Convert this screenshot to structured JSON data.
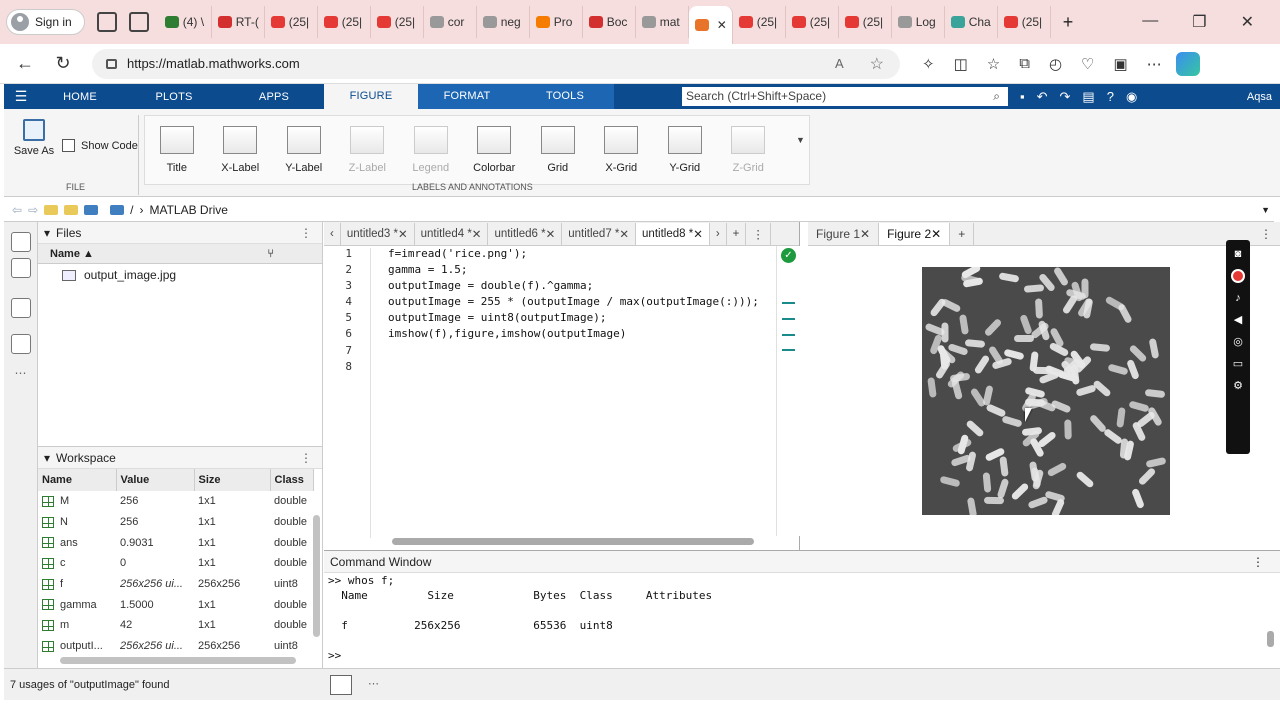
{
  "browser": {
    "signin_label": "Sign in",
    "tabs": [
      {
        "label": "(4) \\",
        "color": "#2e7d32"
      },
      {
        "label": "RT-(",
        "color": "#d32f2f"
      },
      {
        "label": "(25|",
        "color": "#e53935"
      },
      {
        "label": "(25|",
        "color": "#e53935"
      },
      {
        "label": "(25|",
        "color": "#e53935"
      },
      {
        "label": "cor",
        "color": "#999999"
      },
      {
        "label": "neg",
        "color": "#999999"
      },
      {
        "label": "Pro",
        "color": "#f57c00"
      },
      {
        "label": "Boc",
        "color": "#d32f2f"
      },
      {
        "label": "mat",
        "color": "#999999"
      },
      {
        "label": "",
        "color": "#e8742a"
      },
      {
        "label": "(25|",
        "color": "#e53935"
      },
      {
        "label": "(25|",
        "color": "#e53935"
      },
      {
        "label": "(25|",
        "color": "#e53935"
      },
      {
        "label": "Log",
        "color": "#999999"
      },
      {
        "label": "Cha",
        "color": "#3aa39a"
      },
      {
        "label": "(25|",
        "color": "#e53935"
      }
    ],
    "url": "https://matlab.mathworks.com",
    "aa_label": "Aᴬ"
  },
  "matlab": {
    "tabs": [
      "HOME",
      "PLOTS",
      "APPS",
      "FIGURE",
      "FORMAT",
      "TOOLS"
    ],
    "search_placeholder": "Search (Ctrl+Shift+Space)",
    "user": "Aqsa",
    "ribbon": {
      "save_as": "Save As",
      "show_code": "Show Code",
      "file_group": "FILE",
      "labels_group": "LABELS AND ANNOTATIONS",
      "items": [
        {
          "label": "Title",
          "enabled": true
        },
        {
          "label": "X-Label",
          "enabled": true
        },
        {
          "label": "Y-Label",
          "enabled": true
        },
        {
          "label": "Z-Label",
          "enabled": false
        },
        {
          "label": "Legend",
          "enabled": false
        },
        {
          "label": "Colorbar",
          "enabled": true
        },
        {
          "label": "Grid",
          "enabled": true
        },
        {
          "label": "X-Grid",
          "enabled": true
        },
        {
          "label": "Y-Grid",
          "enabled": true
        },
        {
          "label": "Z-Grid",
          "enabled": false
        }
      ]
    },
    "path": {
      "root": "/",
      "folder": "MATLAB Drive"
    },
    "files": {
      "title": "Files",
      "col_name": "Name ▲",
      "items": [
        "output_image.jpg"
      ]
    },
    "workspace": {
      "title": "Workspace",
      "columns": [
        "Name",
        "Value",
        "Size",
        "Class"
      ],
      "rows": [
        {
          "name": "M",
          "value": "256",
          "size": "1x1",
          "class": "double",
          "italic": false
        },
        {
          "name": "N",
          "value": "256",
          "size": "1x1",
          "class": "double",
          "italic": false
        },
        {
          "name": "ans",
          "value": "0.9031",
          "size": "1x1",
          "class": "double",
          "italic": false
        },
        {
          "name": "c",
          "value": "0",
          "size": "1x1",
          "class": "double",
          "italic": false
        },
        {
          "name": "f",
          "value": "256x256 ui...",
          "size": "256x256",
          "class": "uint8",
          "italic": true
        },
        {
          "name": "gamma",
          "value": "1.5000",
          "size": "1x1",
          "class": "double",
          "italic": false
        },
        {
          "name": "m",
          "value": "42",
          "size": "1x1",
          "class": "double",
          "italic": false
        },
        {
          "name": "outputI...",
          "value": "256x256 ui...",
          "size": "256x256",
          "class": "uint8",
          "italic": true
        }
      ]
    },
    "editor": {
      "tabs": [
        "untitled3 *",
        "untitled4 *",
        "untitled6 *",
        "untitled7 *",
        "untitled8 *"
      ],
      "active_tab": "untitled8 *",
      "lines": [
        "f=imread('rice.png');",
        "gamma = 1.5;",
        "outputImage = double(f).^gamma;",
        "outputImage = 255 * (outputImage / max(outputImage(:)));",
        "outputImage = uint8(outputImage);",
        "imshow(f),figure,imshow(outputImage)",
        "",
        ""
      ]
    },
    "figures": {
      "tabs": [
        "Figure 1",
        "Figure 2"
      ],
      "active": "Figure 2"
    },
    "command_window": {
      "title": "Command Window",
      "lines": [
        ">> whos f;",
        "  Name         Size            Bytes  Class     Attributes",
        "",
        "  f          256x256           65536  uint8",
        "",
        ">>"
      ]
    },
    "status": "7 usages of \"outputImage\" found"
  }
}
